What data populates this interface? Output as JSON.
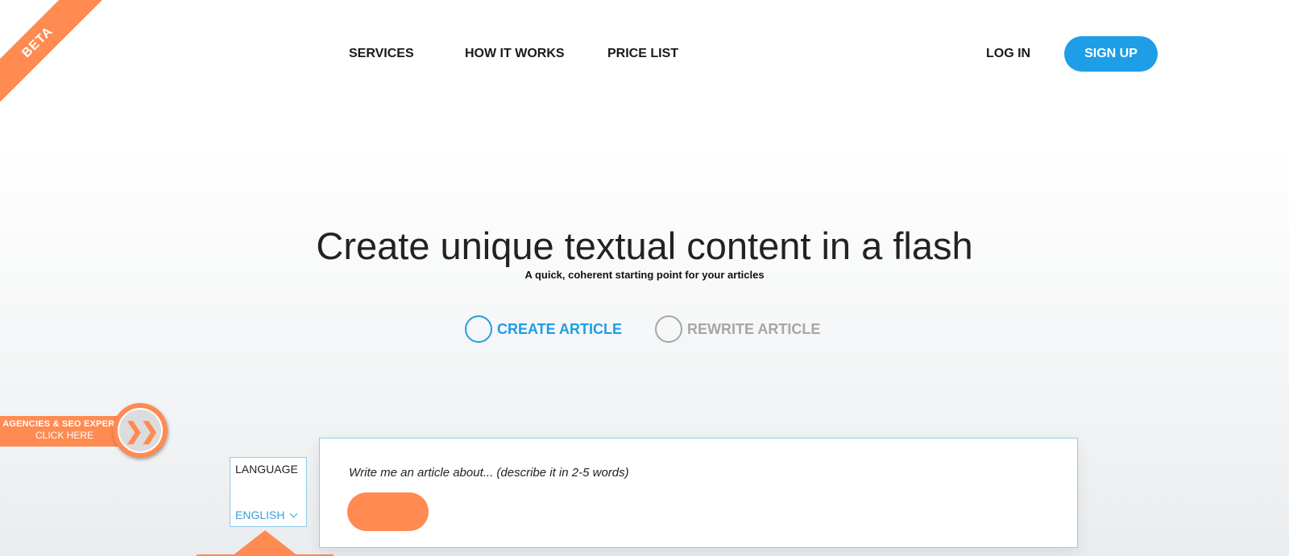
{
  "beta_ribbon": "BETA",
  "nav": {
    "services": "SERVICES",
    "how_it_works": "HOW IT WORKS",
    "price_list": "PRICE LIST",
    "login": "LOG IN",
    "signup": "SIGN UP"
  },
  "hero": {
    "title": "Create unique textual content in a flash",
    "subtitle": "A quick, coherent starting point for your articles"
  },
  "modes": {
    "create": "CREATE ARTICLE",
    "rewrite": "REWRITE ARTICLE",
    "selected": "create"
  },
  "agencies": {
    "line1": "AGENCIES & SEO EXPERTS",
    "line2": "CLICK HERE",
    "arrows": "❯❯"
  },
  "language": {
    "label": "LANGUAGE",
    "selected": "ENGLISH"
  },
  "article_form": {
    "placeholder": "Write me an article about... (describe it in 2-5 words)",
    "value": ""
  },
  "colors": {
    "accent_blue": "#1d9ee6",
    "accent_orange": "#ff8a52",
    "muted_gray": "#a6a6a6"
  },
  "icons": {
    "agencies_arrow": "double-chevron-right-icon",
    "language_dropdown": "chevron-down-icon"
  }
}
